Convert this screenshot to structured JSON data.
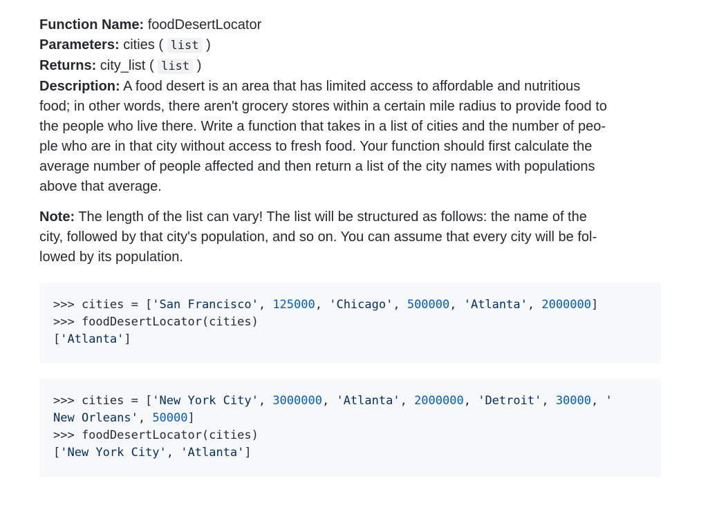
{
  "function_name": {
    "label": "Function Name:",
    "value": "foodDesertLocator"
  },
  "parameters": {
    "label": "Parameters:",
    "name": "cities",
    "open": "(",
    "type": "list",
    "close": ")"
  },
  "returns": {
    "label": "Returns:",
    "name": "city_list",
    "open": "(",
    "type": "list",
    "close": ")"
  },
  "description": {
    "label": "Description:",
    "lines": [
      "A food desert is an area that has limited access to affordable and nutritious",
      "food; in other words, there aren't grocery stores within a certain mile radius to provide food to",
      "the people who live there. Write a function that takes in a list of cities and the number of peo-",
      "ple who are in that city without access to fresh food. Your function should first calculate the",
      "average number of people affected and then return a list of the city names with populations",
      "above that average."
    ]
  },
  "note": {
    "label": "Note:",
    "lines": [
      "The length of the list can vary! The list will be structured as follows: the name of the",
      "city, followed by that city's population, and so on. You can assume that every city will be fol-",
      "lowed by its population."
    ]
  },
  "example1": {
    "prompt1": ">>> cities = [",
    "s1": "'San Francisco'",
    "c1": ", ",
    "n1": "125000",
    "c2": ", ",
    "s2": "'Chicago'",
    "c3": ", ",
    "n2": "500000",
    "c4": ", ",
    "s3": "'Atlanta'",
    "c5": ", ",
    "n3": "2000000",
    "end1": "]",
    "prompt2": ">>> foodDesertLocator(cities)",
    "out_open": "[",
    "out_s1": "'Atlanta'",
    "out_close": "]"
  },
  "example2": {
    "prompt1": ">>> cities = [",
    "s1": "'New York City'",
    "c1": ", ",
    "n1": "3000000",
    "c2": ", ",
    "s2": "'Atlanta'",
    "c3": ", ",
    "n2": "2000000",
    "c4": ", ",
    "s3": "'Detroit'",
    "c5": ", ",
    "n3": "30000",
    "c6": ", ",
    "s4a": "'",
    "s4b": "New Orleans'",
    "c7": ", ",
    "n4": "50000",
    "end1": "]",
    "prompt2": ">>> foodDesertLocator(cities)",
    "out_open": "[",
    "out_s1": "'New York City'",
    "out_c1": ", ",
    "out_s2": "'Atlanta'",
    "out_close": "]"
  }
}
